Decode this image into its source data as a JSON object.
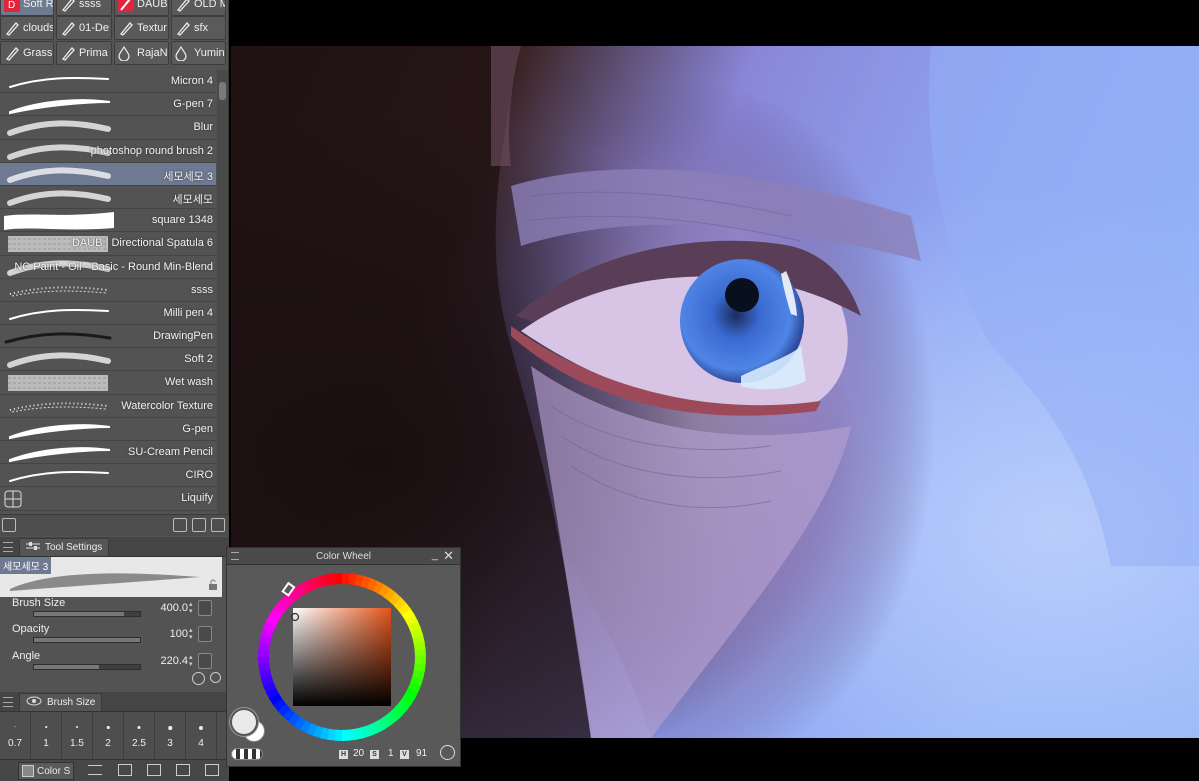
{
  "subtool_tabs": [
    {
      "label": "Soft R",
      "icon": "brush-icon",
      "active": true
    },
    {
      "label": "ssss",
      "icon": "pen-nib-icon",
      "active": false
    },
    {
      "label": "DAUB",
      "icon": "daub-brush-icon",
      "active": false
    },
    {
      "label": "OLD M",
      "icon": "pen-nib-icon",
      "active": false
    },
    {
      "label": "clouds",
      "icon": "pen-nib-icon",
      "active": false
    },
    {
      "label": "01-De",
      "icon": "pen-nib-icon",
      "active": false
    },
    {
      "label": "Textur",
      "icon": "pen-nib-icon",
      "active": false
    },
    {
      "label": "sfx",
      "icon": "pen-nib-icon",
      "active": false
    },
    {
      "label": "Grass",
      "icon": "pen-nib-icon",
      "active": false
    },
    {
      "label": "Prima",
      "icon": "pen-nib-icon",
      "active": false
    },
    {
      "label": "RajaN",
      "icon": "water-drop-icon",
      "active": false
    },
    {
      "label": "Yumin",
      "icon": "water-drop-icon",
      "active": false
    }
  ],
  "brushes": [
    {
      "name": "Micron 4",
      "stroke": "thin"
    },
    {
      "name": "G-pen 7",
      "stroke": "taper"
    },
    {
      "name": "Blur",
      "stroke": "soft"
    },
    {
      "name": "photoshop round  brush 2",
      "stroke": "soft"
    },
    {
      "name": "세모세모 3",
      "stroke": "soft",
      "selected": true
    },
    {
      "name": "세모세모",
      "stroke": "soft"
    },
    {
      "name": "square 1348",
      "stroke": "square"
    },
    {
      "name": "DAUB | Directional Spatula 6",
      "stroke": "texture"
    },
    {
      "name": "NC Paint - Oil - Basic - Round Min-Blend",
      "stroke": "soft"
    },
    {
      "name": "ssss",
      "stroke": "speckle"
    },
    {
      "name": "Milli pen 4",
      "stroke": "thin"
    },
    {
      "name": "DrawingPen",
      "stroke": "dark"
    },
    {
      "name": "Soft 2",
      "stroke": "soft"
    },
    {
      "name": "Wet wash",
      "stroke": "texture"
    },
    {
      "name": "Watercolor Texture",
      "stroke": "speckle"
    },
    {
      "name": "G-pen",
      "stroke": "taper"
    },
    {
      "name": "SU-Cream Pencil",
      "stroke": "taper"
    },
    {
      "name": "CIRO",
      "stroke": "thin"
    },
    {
      "name": "Liquify",
      "stroke": "liquify"
    }
  ],
  "tool_settings": {
    "tab_label": "Tool Settings",
    "preset_name": "세모세모 3",
    "rows": [
      {
        "label": "Brush Size",
        "value": "400.0",
        "fill": 0.85
      },
      {
        "label": "Opacity",
        "value": "100",
        "fill": 1.0
      },
      {
        "label": "Angle",
        "value": "220.4",
        "fill": 0.61
      }
    ]
  },
  "brush_size_panel": {
    "tab_label": "Brush Size",
    "sizes": [
      "0.7",
      "1",
      "1.5",
      "2",
      "2.5",
      "3",
      "4"
    ]
  },
  "bottom_tabs": {
    "color_label": "Color S"
  },
  "color_wheel": {
    "title": "Color Wheel",
    "minimize": "_",
    "close": "✕",
    "h_tag": "H",
    "h": "20",
    "s_tag": "S",
    "s": "1",
    "v_tag": "V",
    "v": "91",
    "main_color": "#ebe8e8",
    "sub_color": "#ffffff",
    "hue_color": "#e2541a"
  },
  "colors": {
    "panel_bg": "#535353",
    "selected_row": "#6e7a94",
    "canvas_bg": "#000000"
  }
}
